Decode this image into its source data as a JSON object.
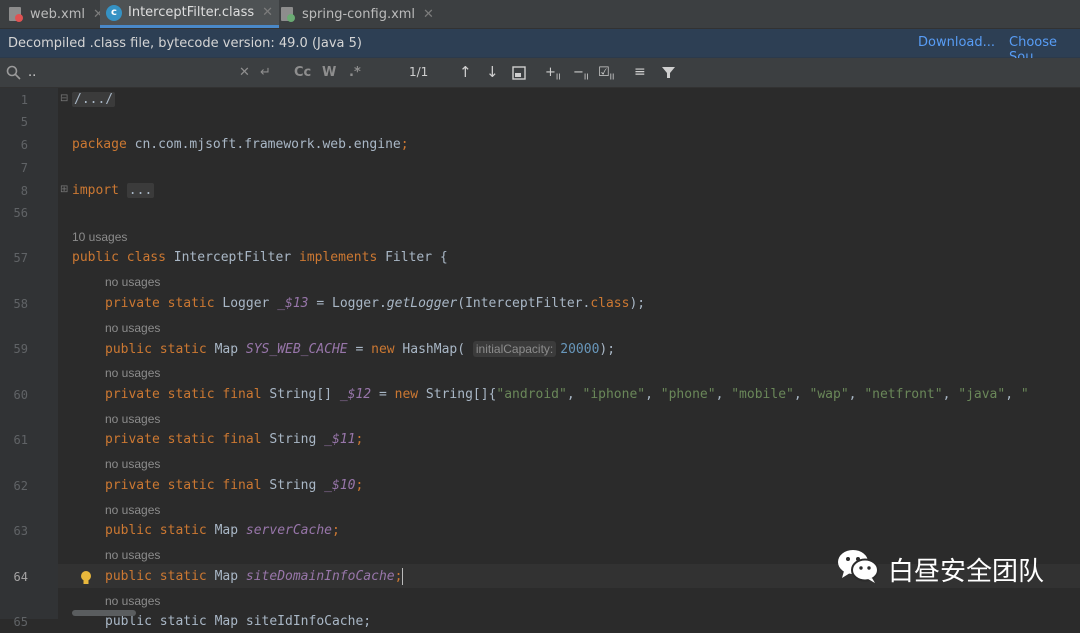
{
  "tabs": [
    {
      "label": "web.xml",
      "icon": "xml-file-icon"
    },
    {
      "label": "InterceptFilter.class",
      "icon": "class-file-icon",
      "active": true
    },
    {
      "label": "spring-config.xml",
      "icon": "spring-xml-icon"
    }
  ],
  "banner": {
    "message": "Decompiled .class file, bytecode version: 49.0 (Java 5)",
    "download": "Download...",
    "choose": "Choose Sou"
  },
  "find": {
    "query": "..",
    "case_label": "Cc",
    "word_label": "W",
    "regex_label": ".*",
    "count": "1/1"
  },
  "editor": {
    "lines": [
      {
        "num": "1",
        "fold": "/.../"
      },
      {
        "num": "5"
      },
      {
        "num": "6",
        "kw": "package",
        "text": " cn.com.mjsoft.framework.web.engine",
        "semi": ";"
      },
      {
        "num": "7"
      },
      {
        "num": "8",
        "kw": "import",
        "fold": "..."
      },
      {
        "num": "56"
      },
      {
        "num": "57",
        "usages": "10 usages"
      },
      {
        "num": "58",
        "usages": "no usages"
      },
      {
        "num": "59",
        "usages": "no usages"
      },
      {
        "num": "60",
        "usages": "no usages"
      },
      {
        "num": "61",
        "usages": "no usages"
      },
      {
        "num": "62",
        "usages": "no usages"
      },
      {
        "num": "63",
        "usages": "no usages"
      },
      {
        "num": "64",
        "usages": "no usages"
      },
      {
        "num": "65",
        "usages": "no usages"
      }
    ],
    "class_decl": {
      "public": "public",
      "class": "class",
      "name": " InterceptFilter ",
      "implements": "implements",
      "rest": " Filter {"
    },
    "l58": {
      "kw": "private static",
      "type": " Logger ",
      "field": "_$13",
      "eq": " = Logger.",
      "call": "getLogger",
      "rest": "(InterceptFilter.",
      "cls": "class",
      "end": ");"
    },
    "l59": {
      "kw": "public static",
      "type": " Map ",
      "field": "SYS_WEB_CACHE",
      "eq": " = ",
      "new": "new",
      "rest": " HashMap(",
      "param": "initialCapacity:",
      "num": "20000",
      "end": ");"
    },
    "l60": {
      "kw": "private static final",
      "type": " String[] ",
      "field": "_$12",
      "eq": " = ",
      "new": "new",
      "rest": " String[]{",
      "strings": [
        "\"android\"",
        "\"iphone\"",
        "\"phone\"",
        "\"mobile\"",
        "\"wap\"",
        "\"netfront\"",
        "\"java\"",
        "\""
      ]
    },
    "l61": {
      "kw": "private static final",
      "type": " String ",
      "field": "_$11",
      "semi": ";"
    },
    "l62": {
      "kw": "private static final",
      "type": " String ",
      "field": "_$10",
      "semi": ";"
    },
    "l63": {
      "kw": "public static",
      "type": " Map ",
      "field": "serverCache",
      "semi": ";"
    },
    "l64": {
      "kw": "public static",
      "type": " Map ",
      "field": "siteDomainInfoCache",
      "semi": ";"
    },
    "l65": {
      "partial": "public static Map siteIdInfoCache;"
    }
  },
  "watermark": {
    "text": "白昼安全团队",
    "icon": "wechat-icon"
  },
  "colors": {
    "keyword": "#cc7832",
    "field": "#9876aa",
    "string": "#6a8759",
    "number": "#6897bb",
    "accent": "#4a88c7",
    "link": "#589df6"
  }
}
